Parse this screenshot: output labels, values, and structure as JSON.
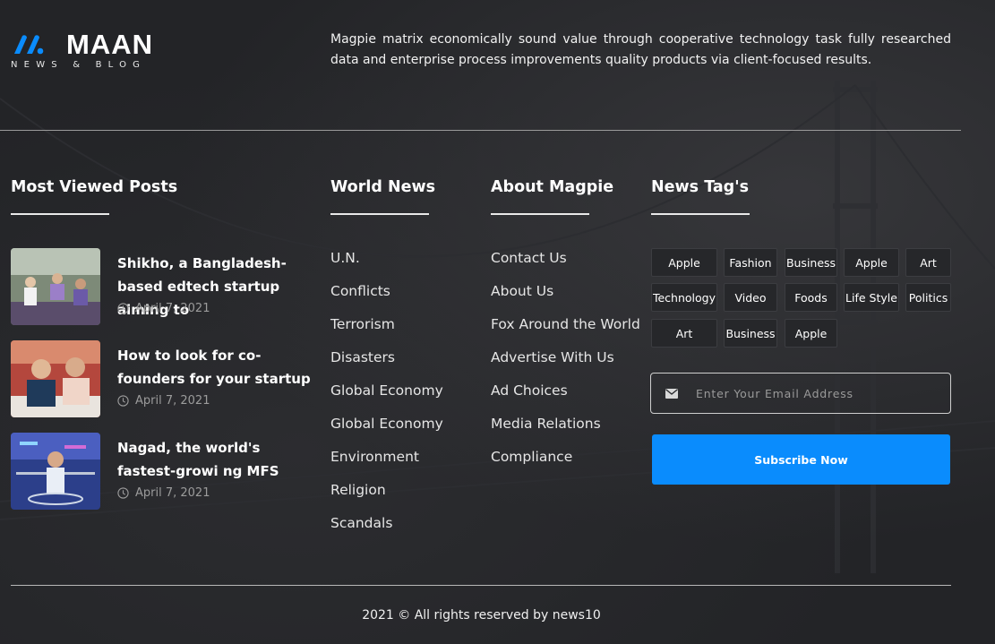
{
  "brand": {
    "name": "MAAN",
    "tagline": "NEWS & BLOG",
    "accent": "#0a8cfd"
  },
  "intro": "Magpie matrix economically sound value through cooperative technology task fully researched data and enterprise process improvements quality products via client-focused results.",
  "columns": {
    "most_viewed": "Most Viewed Posts",
    "world_news": "World News",
    "about": "About Magpie",
    "tags": "News Tag's"
  },
  "posts": [
    {
      "title": "Shikho, a Bangladesh-based edtech startup aiming to",
      "date": "April 7, 2021"
    },
    {
      "title": "How to look for co-founders for your startup",
      "date": "April 7, 2021"
    },
    {
      "title": "Nagad, the world's fastest-growi ng MFS",
      "date": "April 7, 2021"
    }
  ],
  "world_news": [
    "U.N.",
    "Conflicts",
    "Terrorism",
    "Disasters",
    "Global Economy",
    "Global Economy",
    "Environment",
    "Religion",
    "Scandals"
  ],
  "about_links": [
    "Contact Us",
    "About Us",
    "Fox Around the World",
    "Advertise With Us",
    "Ad Choices",
    "Media Relations",
    "Compliance"
  ],
  "tags": [
    "Apple",
    "Fashion",
    "Business",
    "Apple",
    "Art",
    "Technology",
    "Video",
    "Foods",
    "Life Style",
    "Politics",
    "Art",
    "Business",
    "Apple"
  ],
  "newsletter": {
    "placeholder": "Enter Your Email Address",
    "button": "Subscribe Now"
  },
  "copyright": "2021 © All rights reserved by news10"
}
